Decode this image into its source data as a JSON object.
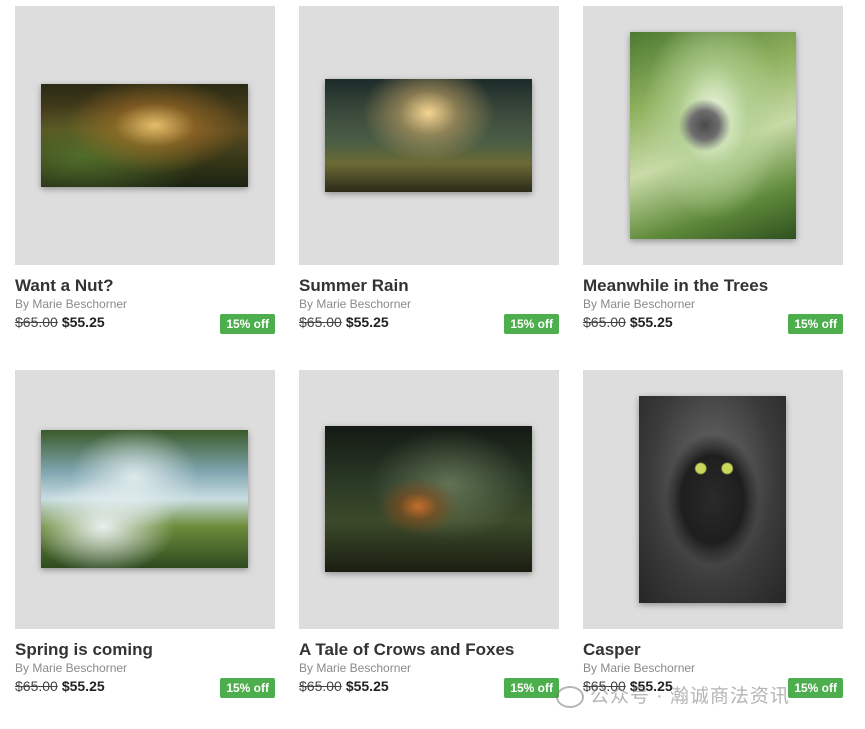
{
  "products": [
    {
      "title": "Want a Nut?",
      "artist": "By Marie Beschorner",
      "old_price": "$65.00",
      "new_price": "$55.25",
      "badge": "15% off"
    },
    {
      "title": "Summer Rain",
      "artist": "By Marie Beschorner",
      "old_price": "$65.00",
      "new_price": "$55.25",
      "badge": "15% off"
    },
    {
      "title": "Meanwhile in the Trees",
      "artist": "By Marie Beschorner",
      "old_price": "$65.00",
      "new_price": "$55.25",
      "badge": "15% off"
    },
    {
      "title": "Spring is coming",
      "artist": "By Marie Beschorner",
      "old_price": "$65.00",
      "new_price": "$55.25",
      "badge": "15% off"
    },
    {
      "title": "A Tale of Crows and Foxes",
      "artist": "By Marie Beschorner",
      "old_price": "$65.00",
      "new_price": "$55.25",
      "badge": "15% off"
    },
    {
      "title": "Casper",
      "artist": "By Marie Beschorner",
      "old_price": "$65.00",
      "new_price": "$55.25",
      "badge": "15% off"
    }
  ],
  "colors": {
    "badge": "#4cae4c",
    "tile": "#dddddd"
  },
  "watermark": {
    "text": "公众号 · 瀚诚商法资讯"
  }
}
